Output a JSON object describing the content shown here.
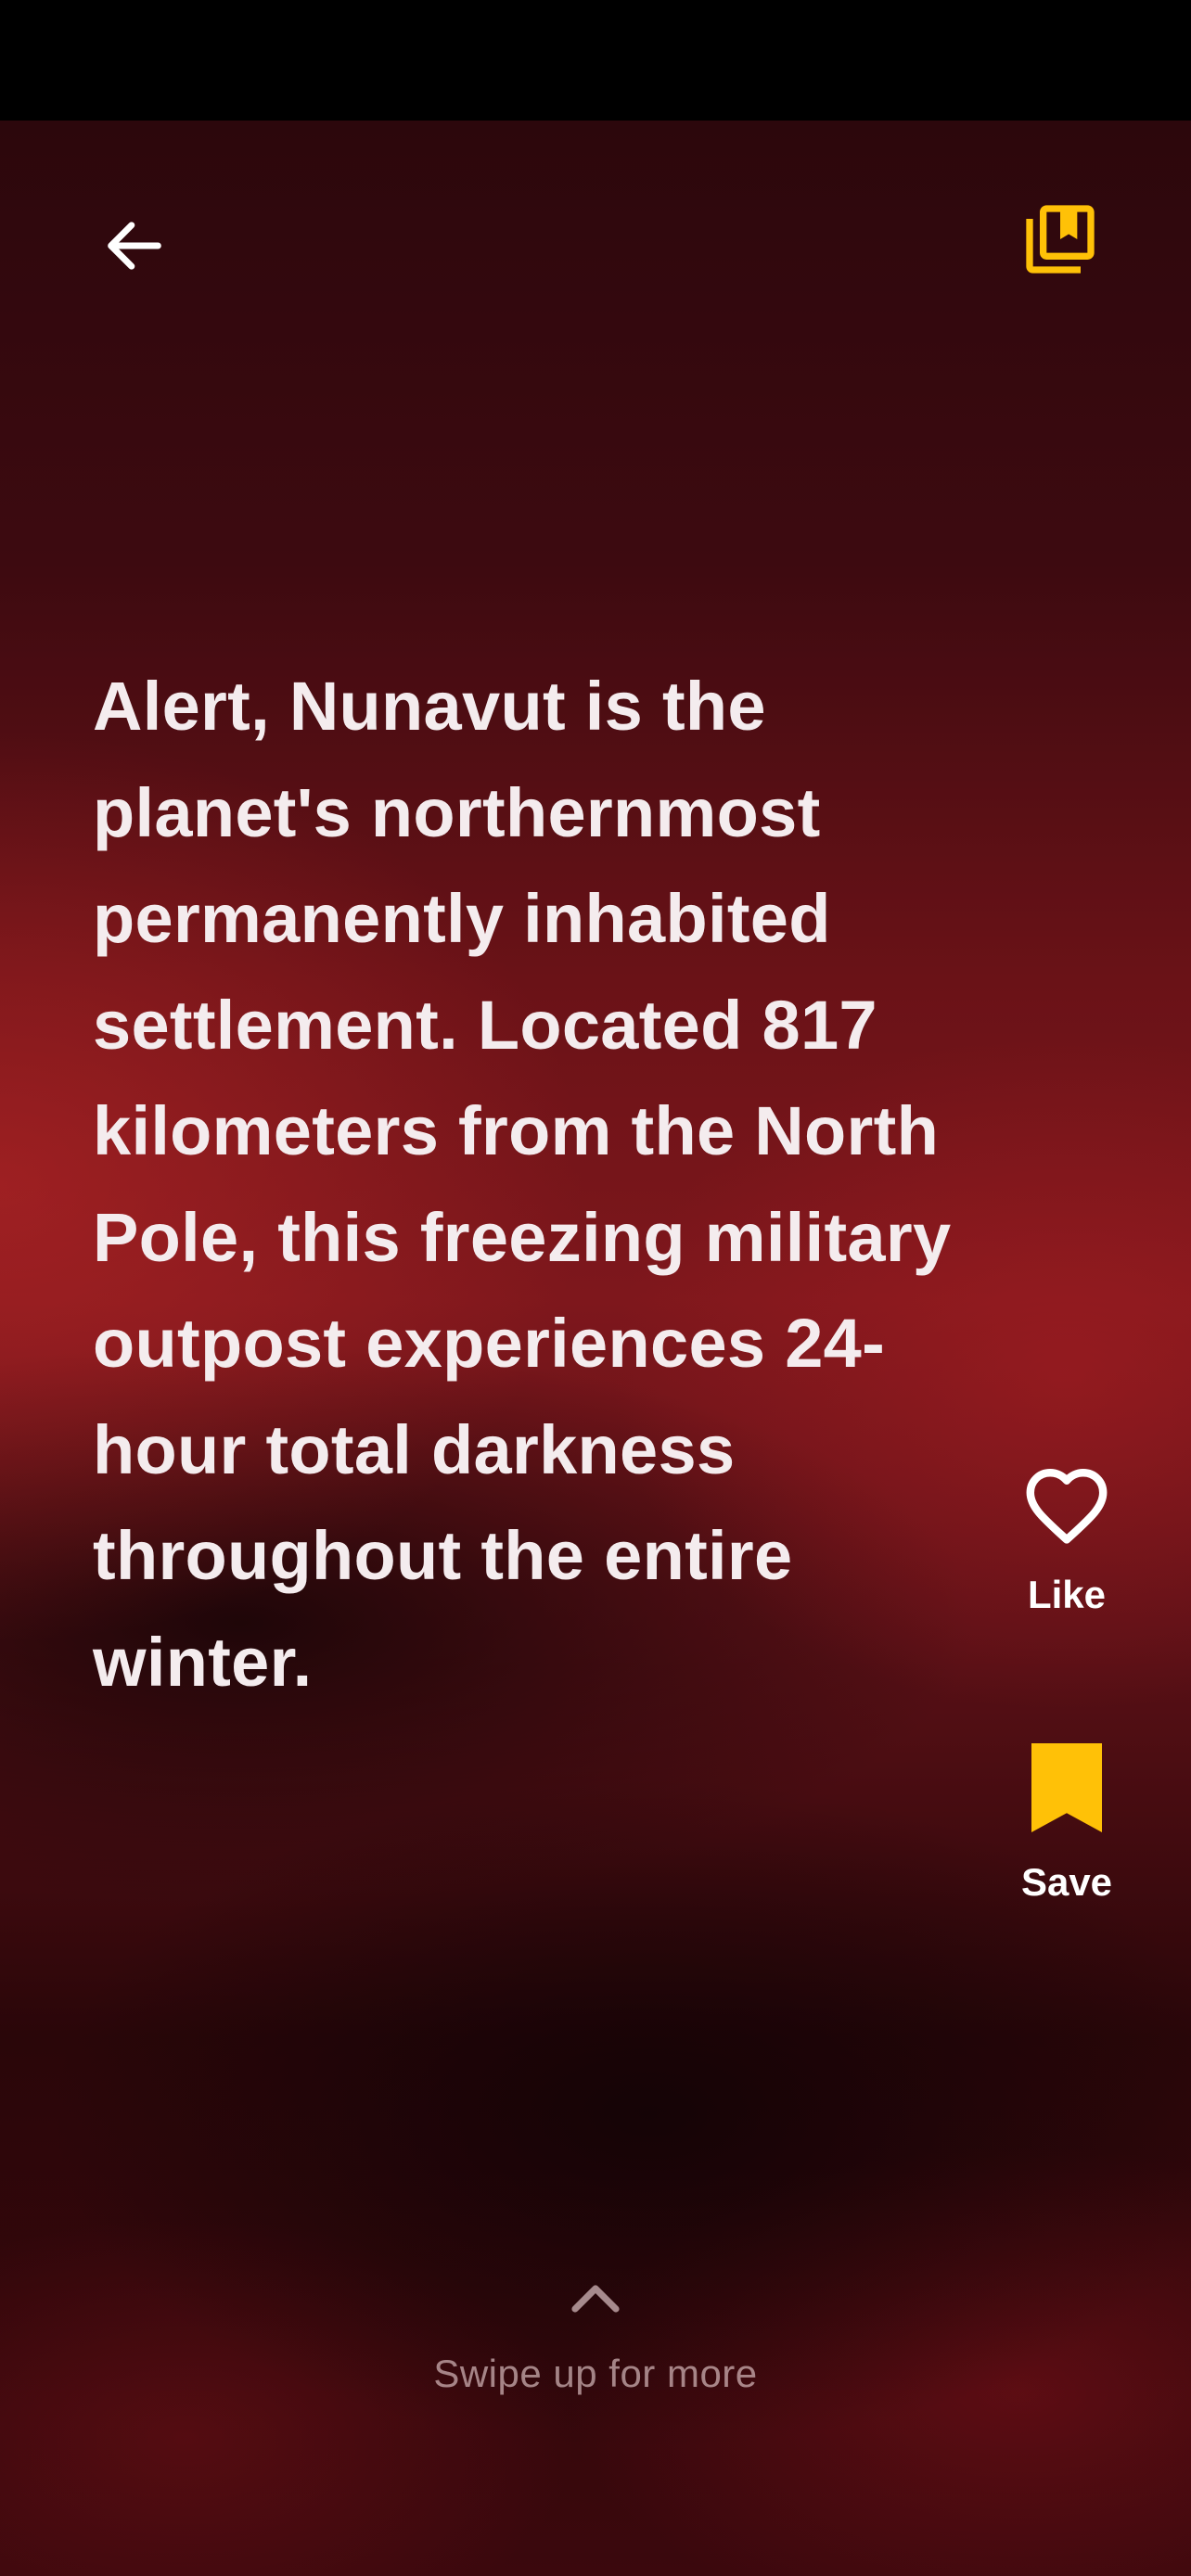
{
  "fact": {
    "text": "Alert, Nunavut is the planet's northernmost permanently inhabited settlement. Located 817 kilometers from the North Pole, this freezing military outpost experiences 24-hour total darkness throughout the entire winter."
  },
  "header": {
    "back_icon": "arrow-left-icon",
    "library_icon": "bookmark-library-icon"
  },
  "actions": {
    "like": {
      "label": "Like",
      "icon": "heart-outline-icon"
    },
    "save": {
      "label": "Save",
      "icon": "bookmark-filled-icon"
    }
  },
  "footer": {
    "swipe_label": "Swipe up for more",
    "icon": "chevron-up-icon"
  },
  "colors": {
    "accent": "#FFC107",
    "text": "#F4ECEE",
    "background": "#6A1217"
  }
}
